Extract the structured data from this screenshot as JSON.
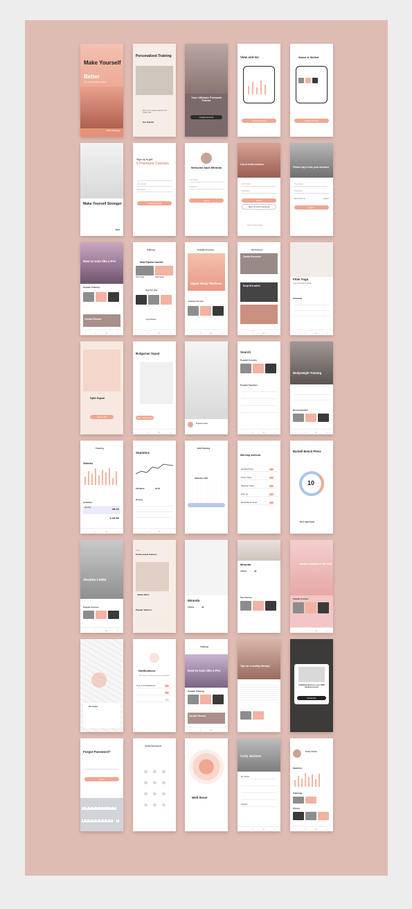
{
  "status": {
    "time": "9:41"
  },
  "onboarding": {
    "make_yourself": "Make Yourself",
    "better": "Better",
    "personal_trainer_sub": "Your personal fitness trainer",
    "start_training": "Start Training",
    "personalized_training": "Personalized Training",
    "personalized_sub": "Easy to use workout planner and tracker with",
    "get_started": "Get Started",
    "ultimate_trainer": "Your Ultimate Personal Trainer",
    "create_account": "Create Account",
    "view_and_go": "View and Go",
    "smart_skilled": "Smart & Skilled",
    "log_in": "Log In"
  },
  "auth": {
    "make_yourself_stronger": "Make Yourself Stronger",
    "next": "Next",
    "sign_up_to_get": "Sign up to get",
    "five_premium": "5 Premium Courses",
    "welcome_back": "Welcome back Miranda",
    "create_account": "Create Account",
    "out_of_trainers": "Out of limits trainers",
    "please_log_in": "Please log in into your account",
    "your_email": "Your Email",
    "password": "Password",
    "remember_me": "Remember me",
    "forgot": "Forgot?",
    "log_in": "Log In",
    "sign_up_facebook": "Sign Up with Facebook",
    "terms": "Terms & Privacy Policy"
  },
  "browse": {
    "how_to_train": "How to train like a Pro",
    "popular_training": "Popular Training",
    "cardio_fitness": "Cardio Fitness",
    "training": "Training",
    "most_popular_courses": "Most Popular Courses",
    "flow_yoga": "Flow Yoga",
    "split_squat": "Split Squat",
    "just_for_you": "Just for you",
    "bulgarian": "Bulgarian",
    "yoga_master": "Yoga Master",
    "popular_courses": "Popular Courses",
    "upper_body_workout": "Upper Body Workout",
    "courses_for_you": "Courses for you",
    "all_courses": "All Courses",
    "cardio_exercises": "Cardio Exercises",
    "keep_fit": "Keep fit & active",
    "flow_yoga_sub": "Keep your body in shape",
    "schedule": "Schedule"
  },
  "workout": {
    "split_squat": "Split Squat",
    "add_to_list": "Add to list",
    "bulgarian_squat": "Bulgarian Squat",
    "next_split_squat": "Next: Split Squat",
    "search": "Search",
    "popular_courses": "Popular Courses",
    "popular_teachers": "Popular Teachers",
    "bodyweight_training": "Bodyweight Training",
    "recommended": "Recommended"
  },
  "stats": {
    "training": "Training",
    "statistics": "Statistics",
    "activities": "Activities",
    "running": "Running",
    "timer1": "45:21",
    "timer2": "1:23:50",
    "history": "History",
    "edit_training": "Edit Training",
    "month": "September, 2023",
    "morning_workout": "Morning workout",
    "exercises": [
      "Dumbbell Flyes",
      "Power Lifting",
      "Bulgarian Squat",
      "Push Up",
      "Barbell Bench Press"
    ],
    "barbell_bench_press": "Barbell Bench Press",
    "count": "10",
    "next_split_squat": "Next: Split Squat",
    "stat_values": [
      "100,5kcal",
      "40:50"
    ]
  },
  "profiles": {
    "jessica_lewis": "Jessica Lewis",
    "popular_courses": "Popular Courses",
    "professional_trainers": "Professional Trainers",
    "trainers_count": "200+",
    "popular_teachers": "Popular Teachers",
    "jackie_west": "Jackie West",
    "miranda": "Miranda",
    "height": "175cm",
    "age": "32",
    "make_yourself_better": "MAKE YOURSELF BETTER",
    "top_courses": "Top Courses"
  },
  "misc": {
    "routes": "16 routes",
    "notifications": "Notifications",
    "notif_sub": "This way we will alert you about new updates",
    "turn_on_all": "Turn on All Notifications",
    "new_courses": "New courses",
    "tips": "Tips for a healthy lifestyle",
    "unlimited": "Unlimited Access to over 2500 training courses",
    "subscribe": "Subscribe",
    "forgot_password": "Forgot Password?",
    "send": "Send",
    "enter_password": "Enter Password",
    "well_done": "Well done!",
    "carly_jackson": "Carly Jackson",
    "carly_jones": "Carly Jones",
    "my_videos": "My Videos",
    "trainings": "Trainings",
    "photos": "Photos",
    "settings": "Settings"
  },
  "colors": {
    "accent": "#f0a690",
    "board": "#dfbcb3",
    "peach": "#f3b2a2"
  }
}
